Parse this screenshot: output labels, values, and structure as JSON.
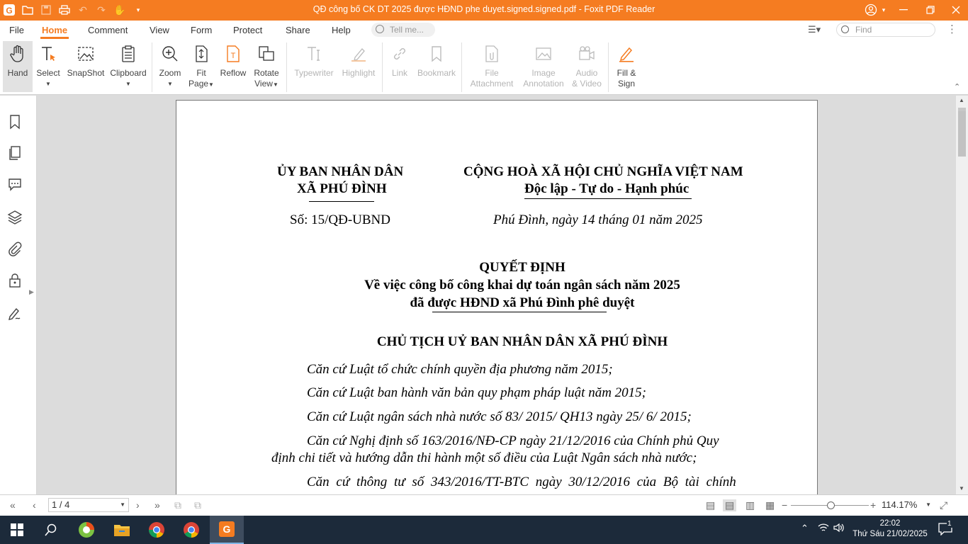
{
  "window": {
    "title": "QĐ công bố  CK DT 2025 được HĐND phe duyet.signed.signed.pdf - Foxit PDF Reader"
  },
  "menu": {
    "file": "File",
    "home": "Home",
    "comment": "Comment",
    "view": "View",
    "form": "Form",
    "protect": "Protect",
    "share": "Share",
    "help": "Help",
    "tellme_placeholder": "Tell me...",
    "find_placeholder": "Find"
  },
  "ribbon": {
    "hand": "Hand",
    "select": "Select",
    "snapshot": "SnapShot",
    "clipboard": "Clipboard",
    "zoom": "Zoom",
    "fit_page_1": "Fit",
    "fit_page_2": "Page",
    "reflow": "Reflow",
    "rotate_1": "Rotate",
    "rotate_2": "View",
    "typewriter": "Typewriter",
    "highlight": "Highlight",
    "link": "Link",
    "bookmark": "Bookmark",
    "file_att_1": "File",
    "file_att_2": "Attachment",
    "image_ann_1": "Image",
    "image_ann_2": "Annotation",
    "audio_1": "Audio",
    "audio_2": "& Video",
    "fill_1": "Fill &",
    "fill_2": "Sign"
  },
  "document": {
    "org_line1": "ỦY BAN NHÂN DÂN",
    "org_line2": "XÃ PHÚ ĐÌNH",
    "nation_line1": "CỘNG HOÀ XÃ HỘI CHỦ NGHĨA VIỆT NAM",
    "nation_line2": "Độc lập - Tự do - Hạnh phúc",
    "number": "Số:  15/QĐ-UBND",
    "place_date": "Phú Đình, ngày 14 tháng 01 năm 2025",
    "decision_title": "QUYẾT ĐỊNH",
    "subject_line1": "Về việc công bố công khai dự toán ngân sách năm 2025",
    "subject_line2": "đã được HĐND xã Phú Đình phê duyệt",
    "issuer": "CHỦ TỊCH UỶ BAN NHÂN DÂN XÃ PHÚ ĐÌNH",
    "basis1": "Căn cứ Luật tổ chức chính quyền địa phương năm 2015;",
    "basis2": "Căn cứ Luật ban hành văn bản quy phạm pháp luật năm 2015;",
    "basis3": "Căn cứ Luật ngân sách nhà nước số 83/ 2015/ QH13 ngày 25/ 6/ 2015;",
    "basis4_line1": "Căn cứ Nghị định số 163/2016/NĐ-CP ngày 21/12/2016 của Chính phủ Quy",
    "basis4_line2": "định chi tiết và hướng dẫn thi hành một số điều của Luật Ngân sách nhà nước;",
    "basis5_line1": "Căn cứ thông tư số 343/2016/TT-BTC ngày 30/12/2016 của Bộ tài chính"
  },
  "status": {
    "page_indicator": "1 / 4",
    "zoom_level": "114.17%"
  },
  "taskbar": {
    "time": "22:02",
    "date": "Thứ Sáu 21/02/2025",
    "notifications": "1"
  },
  "colors": {
    "accent": "#f57c21",
    "taskbar": "#1c2a3a"
  }
}
